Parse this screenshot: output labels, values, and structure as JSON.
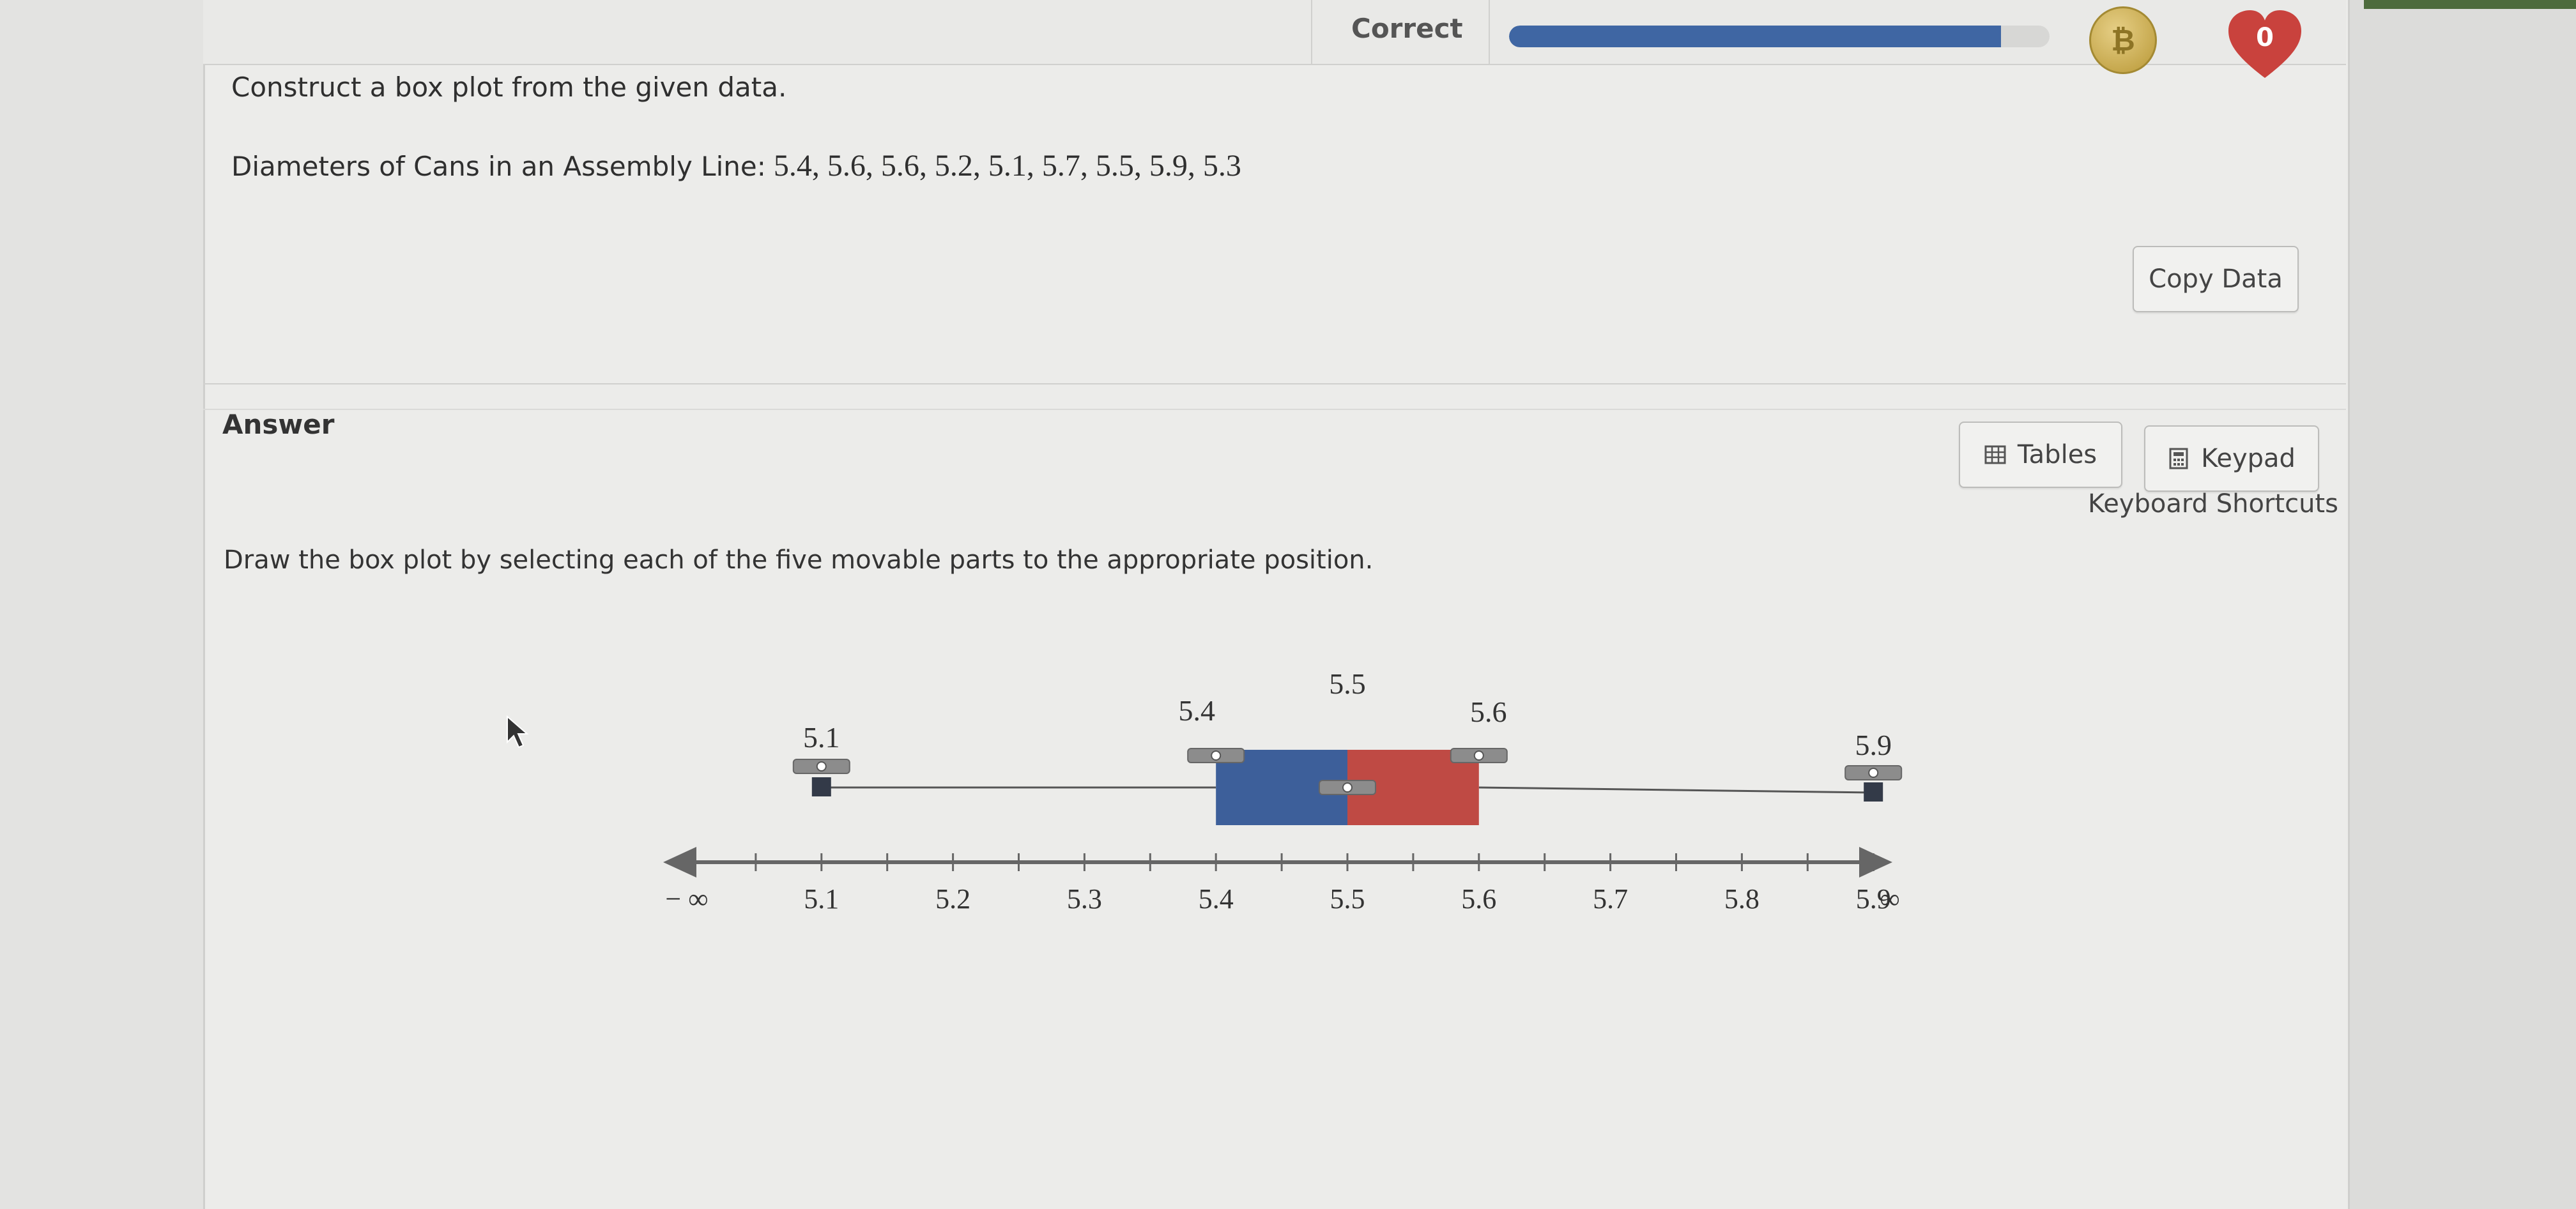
{
  "header": {
    "status_label": "Correct",
    "progress_fraction": 0.91,
    "hearts_count": "0",
    "colors": {
      "progress": "#3f66a3",
      "heart": "#c9423d",
      "coin": "#c9ad52"
    }
  },
  "question": {
    "prompt": "Construct a box plot from the given data.",
    "data_label": "Diameters of Cans in an Assembly Line:",
    "data_values": "5.4, 5.6, 5.6, 5.2, 5.1, 5.7, 5.5, 5.9, 5.3",
    "copy_button": "Copy Data"
  },
  "answer": {
    "label": "Answer",
    "tables_button": "Tables",
    "keypad_button": "Keypad",
    "keyboard_shortcuts": "Keyboard Shortcuts",
    "instruction": "Draw the box plot by selecting each of the five movable parts to the appropriate position."
  },
  "chart_data": {
    "type": "box",
    "axis": {
      "min": 5.0,
      "max": 6.0,
      "tick_labels": [
        "5.1",
        "5.2",
        "5.3",
        "5.4",
        "5.5",
        "5.6",
        "5.7",
        "5.8",
        "5.9"
      ],
      "left_end_label": "− ∞",
      "right_end_label": "∞"
    },
    "five_numbers": {
      "min": 5.1,
      "q1": 5.4,
      "median": 5.5,
      "q3": 5.6,
      "max": 5.9
    },
    "value_labels": {
      "min": "5.1",
      "q1": "5.4",
      "median": "5.5",
      "q3": "5.6",
      "max": "5.9"
    },
    "colors": {
      "lower_box": "#3d5f9a",
      "upper_box": "#bf4a44",
      "whisker": "#555555",
      "axis": "#666666"
    }
  }
}
